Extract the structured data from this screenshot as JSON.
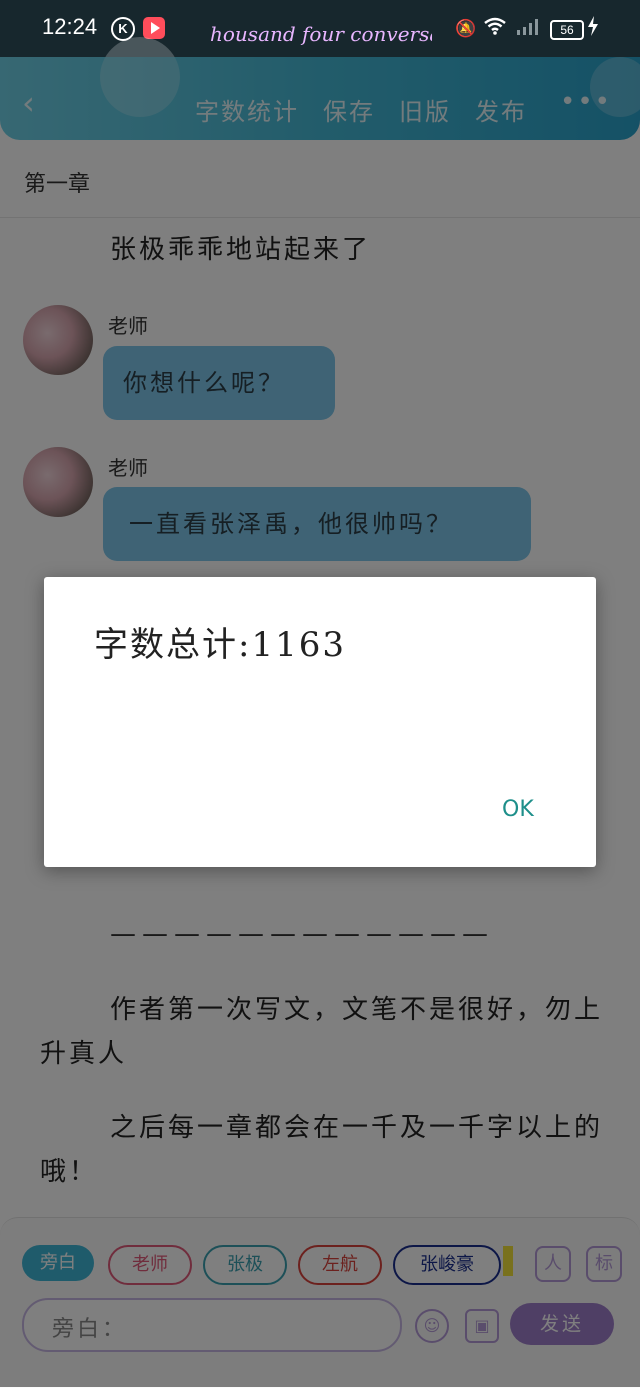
{
  "status_bar": {
    "time": "12:24",
    "k_icon": "K",
    "marquee": "housand four conversa",
    "battery": "56"
  },
  "toolbar": {
    "back_icon": "‹",
    "word_count": "字数统计",
    "save": "保存",
    "old_version": "旧版",
    "publish": "发布",
    "more_icon": "•••"
  },
  "chapter_title": "第一章",
  "story": {
    "para1": "张极乖乖地站起来了",
    "messages": [
      {
        "speaker": "老师",
        "text": "你想什么呢？"
      },
      {
        "speaker": "老师",
        "text": "一直看张泽禹，他很帅吗？"
      }
    ],
    "separator": "————————————",
    "note1": "作者第一次写文，文笔不是很好，勿上升真人",
    "note2": "之后每一章都会在一千及一千字以上的哦！"
  },
  "dialog": {
    "message": "字数总计:1163",
    "ok_label": "OK"
  },
  "bottom_bar": {
    "characters": [
      "旁白",
      "老师",
      "张极",
      "左航",
      "张峻豪"
    ],
    "user_icon": "人",
    "tag_icon": "标",
    "input_placeholder": "旁白：",
    "emoji_icon": "☺",
    "image_icon": "▣",
    "send_label": "发送"
  },
  "colors": {
    "toolbar_start": "#6fd0e6",
    "toolbar_end": "#2aa3cc",
    "bubble": "#7ec7ea",
    "chip_active": "#3fb6d6",
    "chip_teacher": "#e05a7a",
    "chip_zhangji": "#3aa0b0",
    "chip_zuohang": "#d9433c",
    "chip_zhangjunhao": "#1b2f8f",
    "send": "#9f7ecb",
    "ok": "#1e8f8a"
  }
}
